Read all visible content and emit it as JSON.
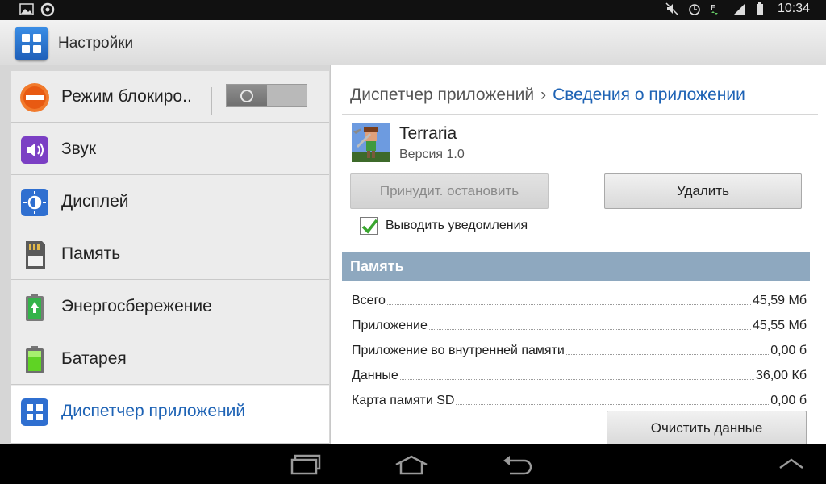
{
  "status_bar": {
    "time": "10:34",
    "icons": [
      "gallery-icon",
      "sync-icon",
      "mute-icon",
      "alarm-icon",
      "data-e-icon",
      "signal-icon",
      "battery-icon"
    ]
  },
  "action_bar": {
    "title": "Настройки",
    "icon": "settings-grid-icon"
  },
  "sidebar": {
    "items": [
      {
        "label": "Режим блокиро..",
        "icon": "block-icon",
        "toggle": "off"
      },
      {
        "label": "Звук",
        "icon": "sound-icon"
      },
      {
        "label": "Дисплей",
        "icon": "display-icon"
      },
      {
        "label": "Память",
        "icon": "sd-card-icon"
      },
      {
        "label": "Энергосбережение",
        "icon": "power-saving-icon"
      },
      {
        "label": "Батарея",
        "icon": "battery-icon"
      },
      {
        "label": "Диспетчер приложений",
        "icon": "app-manager-icon",
        "active": true
      }
    ]
  },
  "main": {
    "breadcrumb": {
      "parent": "Диспетчер приложений",
      "separator": "›",
      "current": "Сведения о приложении"
    },
    "app": {
      "name": "Terraria",
      "version": "Версия 1.0"
    },
    "buttons": {
      "force_stop": "Принудит. остановить",
      "uninstall": "Удалить",
      "clear_data": "Очистить данные"
    },
    "notifications_checkbox": {
      "label": "Выводить уведомления",
      "checked": true
    },
    "memory": {
      "header": "Память",
      "rows": [
        {
          "label": "Всего",
          "value": "45,59 Мб"
        },
        {
          "label": "Приложение",
          "value": "45,55 Мб"
        },
        {
          "label": "Приложение во внутренней памяти",
          "value": "0,00 б"
        },
        {
          "label": "Данные",
          "value": "36,00 Кб"
        },
        {
          "label": "Карта памяти SD",
          "value": "0,00 б"
        }
      ]
    }
  },
  "nav_bar": {
    "icons": [
      "recent-apps-icon",
      "home-icon",
      "back-icon",
      "expand-up-icon"
    ]
  },
  "colors": {
    "accent": "#1e63b5",
    "section_header": "#8ea8bf",
    "checkbox_check": "#3aa62f"
  }
}
